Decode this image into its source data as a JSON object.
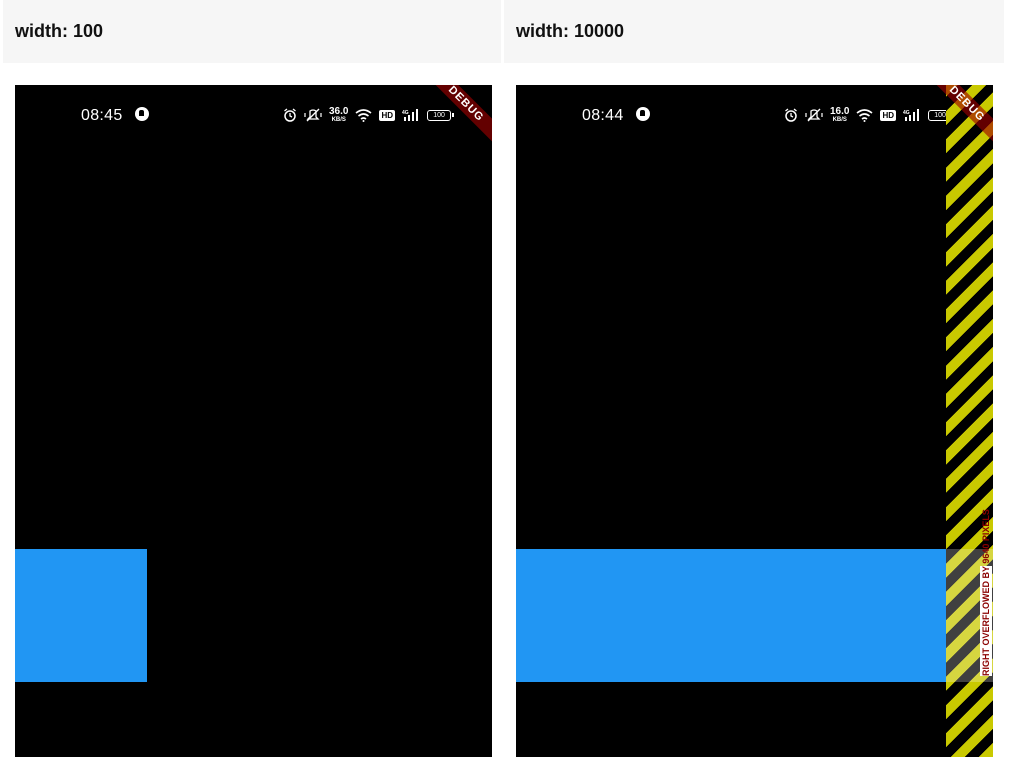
{
  "panels": [
    {
      "header": "width: 100",
      "status": {
        "time": "08:45",
        "net_speed": "36.0",
        "net_unit": "KB/S",
        "network": "4G",
        "hd": "HD",
        "battery": "100"
      },
      "debug_banner": "DEBUG",
      "box": {
        "requested_width": 100,
        "color": "#2196f3"
      }
    },
    {
      "header": "width: 10000",
      "status": {
        "time": "08:44",
        "net_speed": "16.0",
        "net_unit": "KB/S",
        "network": "4G",
        "hd": "HD",
        "battery": "100"
      },
      "debug_banner": "DEBUG",
      "box": {
        "requested_width": 10000,
        "color": "#2196f3"
      },
      "overflow": {
        "message": "RIGHT OVERFLOWED BY 9640 PIXELS",
        "stripe_colors": [
          "#c9c900",
          "#000000"
        ]
      }
    }
  ],
  "colors": {
    "header_bg": "#f6f6f6",
    "screen_bg": "#000000",
    "accent_blue": "#2196f3",
    "debug_red": "#a00000"
  },
  "icons": [
    "app-notification-icon",
    "alarm-icon",
    "mute-vibrate-icon",
    "wifi-icon",
    "signal-icon",
    "battery-icon"
  ]
}
